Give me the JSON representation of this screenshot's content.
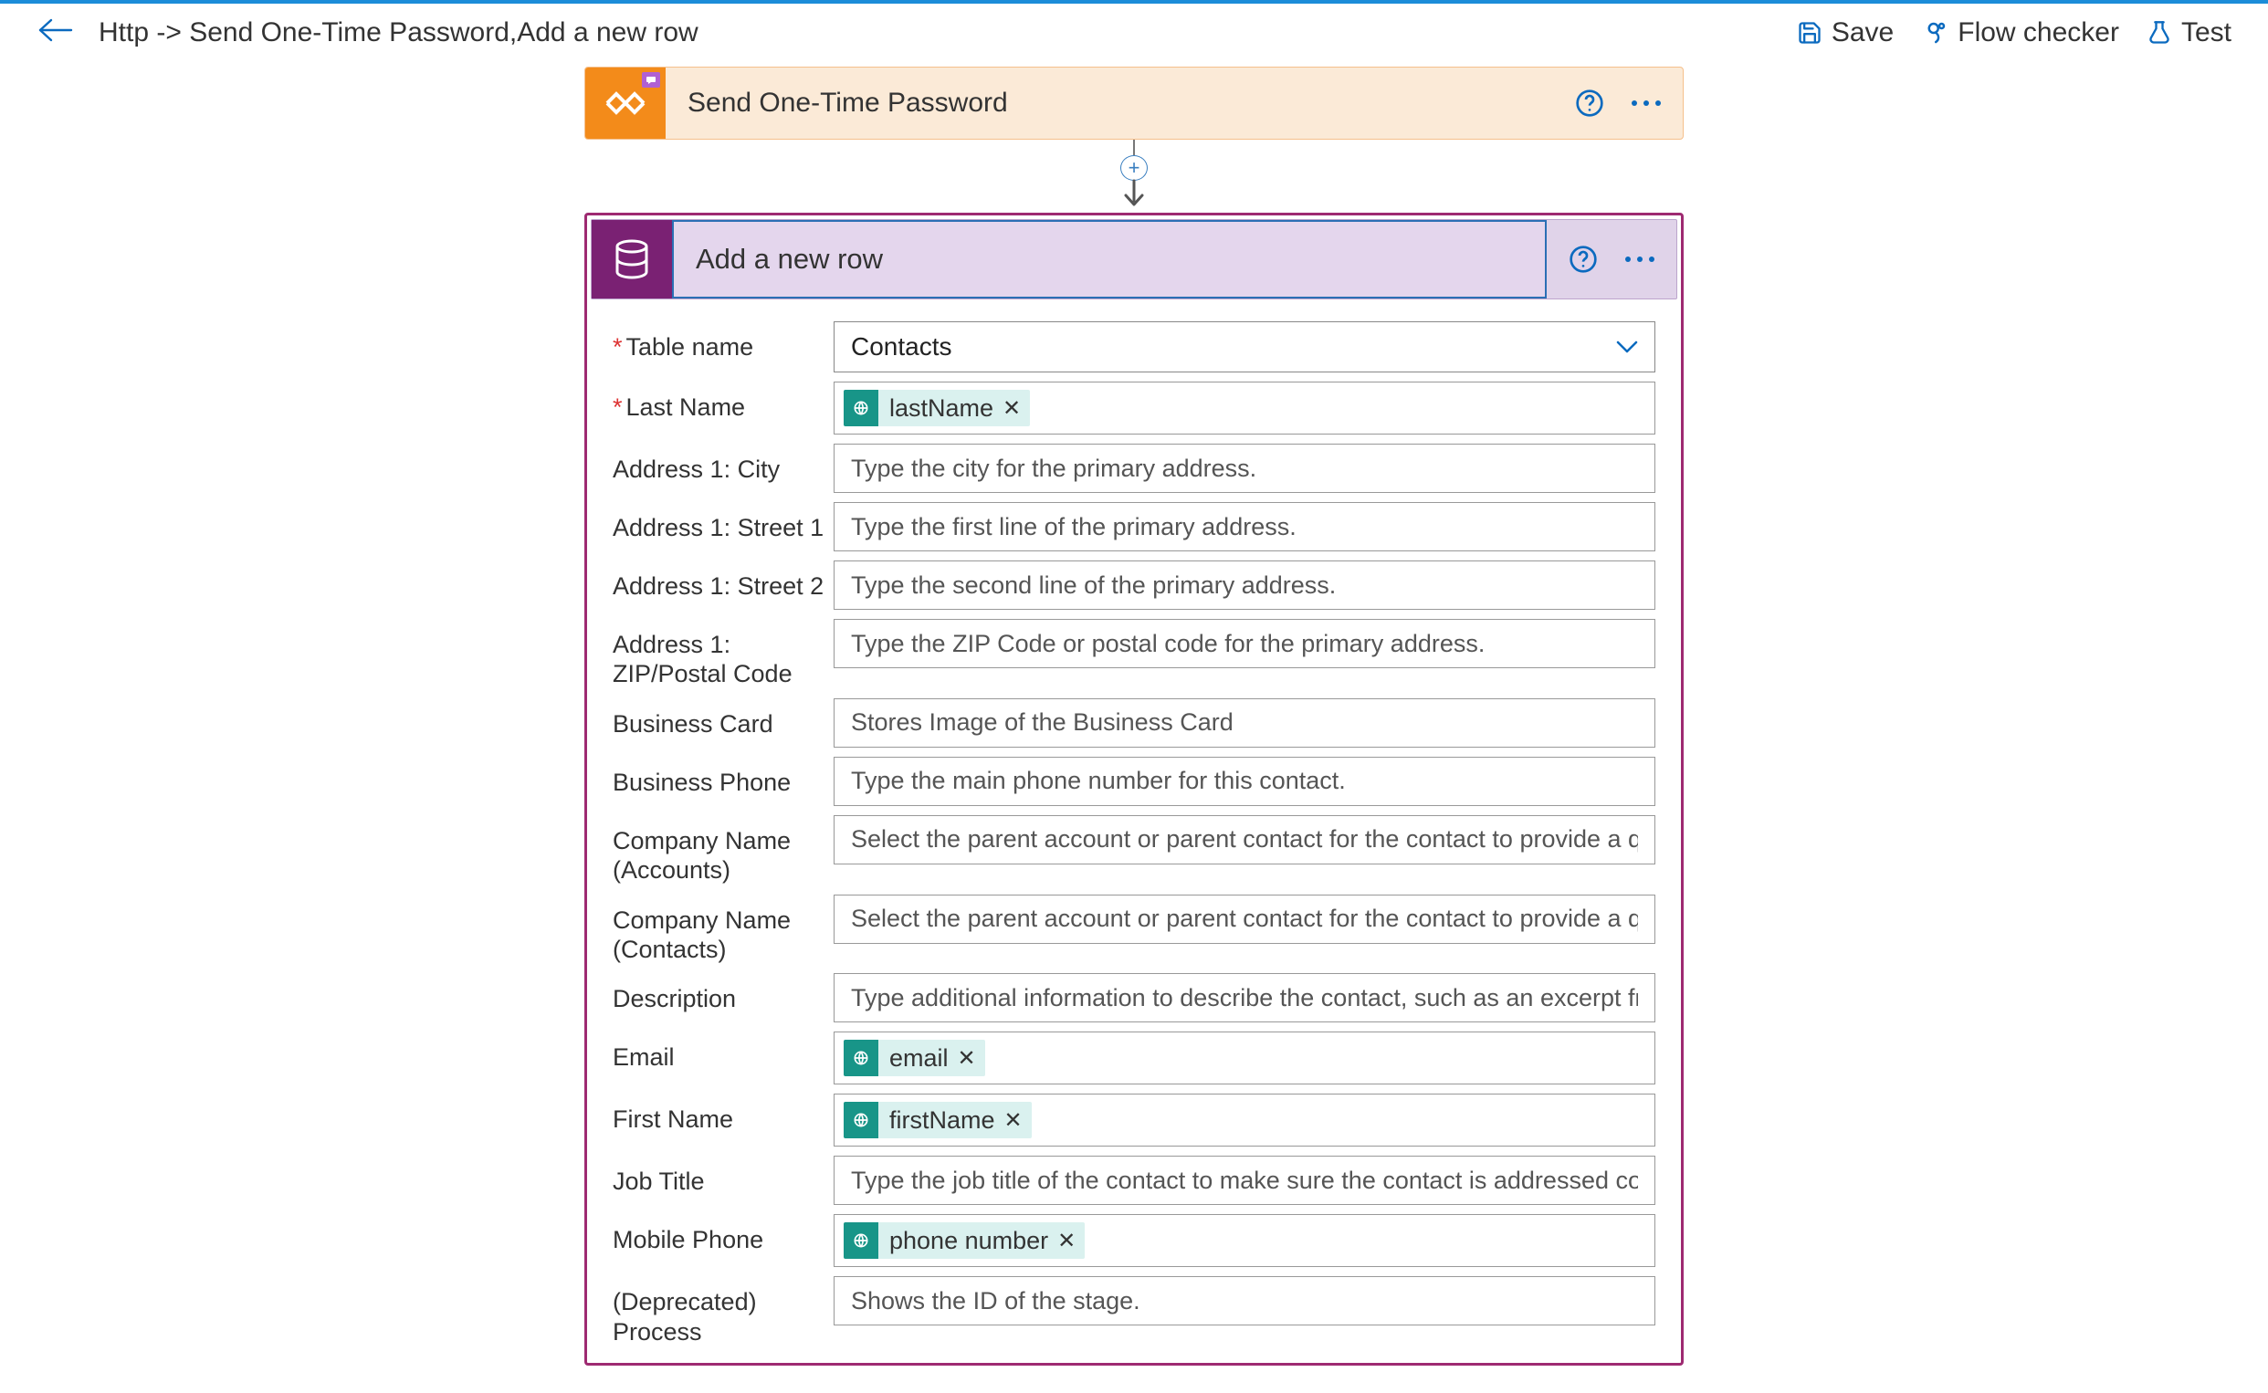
{
  "header": {
    "title": "Http -> Send One-Time Password,Add a new row",
    "buttons": {
      "save": "Save",
      "checker": "Flow checker",
      "test": "Test"
    }
  },
  "prevStep": {
    "title": "Send One-Time Password"
  },
  "currentStep": {
    "title": "Add a new row"
  },
  "form": {
    "table_name_label": "Table name",
    "table_name_value": "Contacts",
    "last_name_label": "Last Name",
    "last_name_token": "lastName",
    "city_label": "Address 1: City",
    "city_ph": "Type the city for the primary address.",
    "street1_label": "Address 1: Street 1",
    "street1_ph": "Type the first line of the primary address.",
    "street2_label": "Address 1: Street 2",
    "street2_ph": "Type the second line of the primary address.",
    "zip_label": "Address 1: ZIP/Postal Code",
    "zip_ph": "Type the ZIP Code or postal code for the primary address.",
    "bizcard_label": "Business Card",
    "bizcard_ph": "Stores Image of the Business Card",
    "bizphone_label": "Business Phone",
    "bizphone_ph": "Type the main phone number for this contact.",
    "comp_acc_label": "Company Name (Accounts)",
    "comp_acc_ph": "Select the parent account or parent contact for the contact to provide a quick link to additional details.",
    "comp_con_label": "Company Name (Contacts)",
    "comp_con_ph": "Select the parent account or parent contact for the contact to provide a quick link to additional details.",
    "desc_label": "Description",
    "desc_ph": "Type additional information to describe the contact, such as an excerpt from the company website.",
    "email_label": "Email",
    "email_token": "email",
    "firstname_label": "First Name",
    "firstname_token": "firstName",
    "jobtitle_label": "Job Title",
    "jobtitle_ph": "Type the job title of the contact to make sure the contact is addressed correctly.",
    "mobile_label": "Mobile Phone",
    "mobile_token": "phone number",
    "process_label": "(Deprecated) Process",
    "process_ph": "Shows the ID of the stage."
  }
}
